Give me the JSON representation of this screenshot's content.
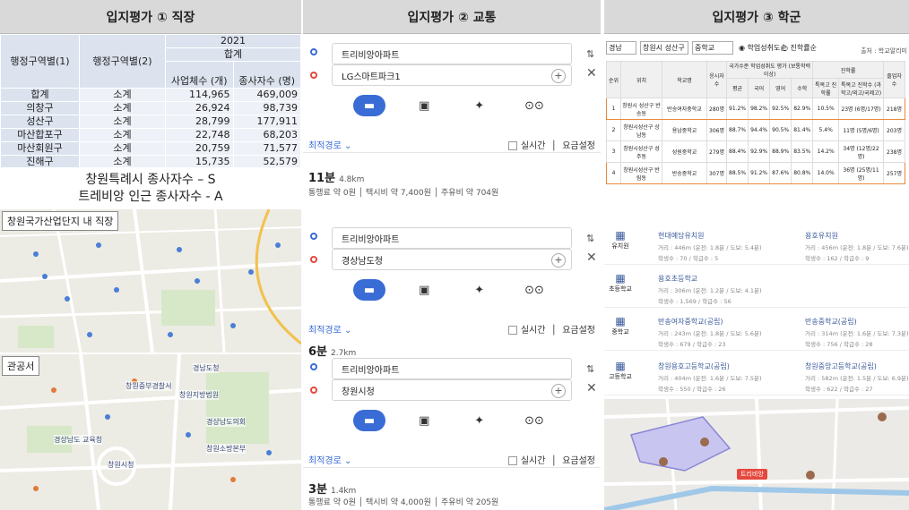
{
  "panel1": {
    "title": "입지평가 ① 직장",
    "table": {
      "col1": "행정구역별(1)",
      "col2": "행정구역별(2)",
      "year": "2021",
      "total": "합계",
      "sub1": "사업체수 (개)",
      "sub2": "종사자수 (명)",
      "rows": [
        {
          "a": "합계",
          "b": "소계",
          "c": "114,965",
          "d": "469,009"
        },
        {
          "a": "의창구",
          "b": "소계",
          "c": "26,924",
          "d": "98,739"
        },
        {
          "a": "성산구",
          "b": "소계",
          "c": "28,799",
          "d": "177,911"
        },
        {
          "a": "마산합포구",
          "b": "소계",
          "c": "22,748",
          "d": "68,203"
        },
        {
          "a": "마산회원구",
          "b": "소계",
          "c": "20,759",
          "d": "71,577"
        },
        {
          "a": "진해구",
          "b": "소계",
          "c": "15,735",
          "d": "52,579"
        }
      ]
    },
    "caption1": "창원특례시 종사자수 – S",
    "caption2": "트레비앙 인근 종사자수 - A",
    "map1_label": "창원국가산업단지 내 직장",
    "map2_label": "관공서",
    "map2_places": [
      "창원시청",
      "창원중부경찰서",
      "경남도청",
      "창원지방법원",
      "경상남도의회",
      "창원소방본부",
      "경상남도 교육청"
    ]
  },
  "panel2": {
    "title": "입지평가 ② 교통",
    "routes": [
      {
        "from": "트리비앙아파트",
        "to": "LG스마트파크1",
        "time": "11분",
        "dist": "4.8km",
        "cost": "통행료 약 0원 │ 택시비 약 7,400원 │ 주유비 약 704원"
      },
      {
        "from": "트리비앙아파트",
        "to": "경상남도청",
        "time": "6분",
        "dist": "2.7km",
        "cost": ""
      },
      {
        "from": "트리비앙아파트",
        "to": "창원시청",
        "time": "3분",
        "dist": "1.4km",
        "cost": "통행료 약 0원 │ 택시비 약 4,000원 │ 주유비 약 205원"
      }
    ],
    "opt_label": "최적경로 ⌄",
    "realtime": "실시간",
    "fare": "요금설정",
    "modes": [
      "car",
      "bus",
      "walk",
      "bike"
    ]
  },
  "panel3": {
    "title": "입지평가 ③ 학군",
    "filters": {
      "f1": "경남",
      "f2": "창원시 성산구",
      "f3": "중학교",
      "r1": "학업성취도순",
      "r2": "진학률순",
      "credit": "출처 : 학교알리미"
    },
    "table": {
      "h": [
        "순위",
        "위치",
        "학교명",
        "응시자수",
        "국가수준 학업성취도 평가 (보통학력이상)",
        "평균",
        "국어",
        "영어",
        "수학",
        "진학률",
        "특목고 진학률",
        "특목고 진학수 (과학고/외고/국제고)",
        "졸업자수"
      ],
      "rows": [
        [
          "1",
          "창원시 성산구 반송동",
          "반송여자중학교",
          "280명",
          "91.2%",
          "98.2%",
          "92.5%",
          "82.9%",
          "10.5%",
          "23명 (6명/17명)",
          "218명"
        ],
        [
          "2",
          "창원시성산구 상남동",
          "용남중학교",
          "306명",
          "88.7%",
          "94.4%",
          "90.5%",
          "81.4%",
          "5.4%",
          "11명 (5명/6명)",
          "203명"
        ],
        [
          "3",
          "창원시성산구 성주동",
          "성원중학교",
          "279명",
          "88.4%",
          "92.9%",
          "88.9%",
          "83.5%",
          "14.2%",
          "34명 (12명/22명)",
          "238명"
        ],
        [
          "4",
          "창원시성산구 반림동",
          "반송중학교",
          "307명",
          "88.5%",
          "91.2%",
          "87.6%",
          "80.8%",
          "14.0%",
          "36명 (25명/11명)",
          "257명"
        ]
      ]
    },
    "groups": [
      {
        "label": "유치원",
        "items": [
          {
            "name": "현대예담유치원",
            "d1": "거리 : 446m (운전: 1.8분 / 도보: 5.4분)",
            "d2": "학생수 : 70 / 학급수 : 5"
          },
          {
            "name": "용호유치원",
            "d1": "거리 : 456m (운전: 1.8분 / 도보: 7.6분)",
            "d2": "학생수 : 162 / 학급수 : 9"
          }
        ]
      },
      {
        "label": "초등학교",
        "items": [
          {
            "name": "용호초등학교",
            "d1": "거리 : 306m (운전: 1.2분 / 도보: 4.1분)",
            "d2": "학생수 : 1,569 / 학급수 : 56"
          }
        ]
      },
      {
        "label": "중학교",
        "items": [
          {
            "name": "반송여자중학교(공립)",
            "d1": "거리 : 243m (운전: 1.8분 / 도보: 5.6분)",
            "d2": "학생수 : 679 / 학급수 : 23"
          },
          {
            "name": "반송중학교(공립)",
            "d1": "거리 : 314m (운전: 1.6분 / 도보: 7.3분)",
            "d2": "학생수 : 756 / 학급수 : 28"
          }
        ]
      },
      {
        "label": "고등학교",
        "items": [
          {
            "name": "창원용호고등학교(공립)",
            "d1": "거리 : 404m (운전: 1.6분 / 도보: 7.5분)",
            "d2": "학생수 : 550 / 학급수 : 26"
          },
          {
            "name": "창원중앙고등학교(공립)",
            "d1": "거리 : 582m (운전: 1.5분 / 도보: 6.9분)",
            "d2": "학생수 : 622 / 학급수 : 27"
          }
        ]
      }
    ],
    "map_marker": "트리비앙"
  }
}
